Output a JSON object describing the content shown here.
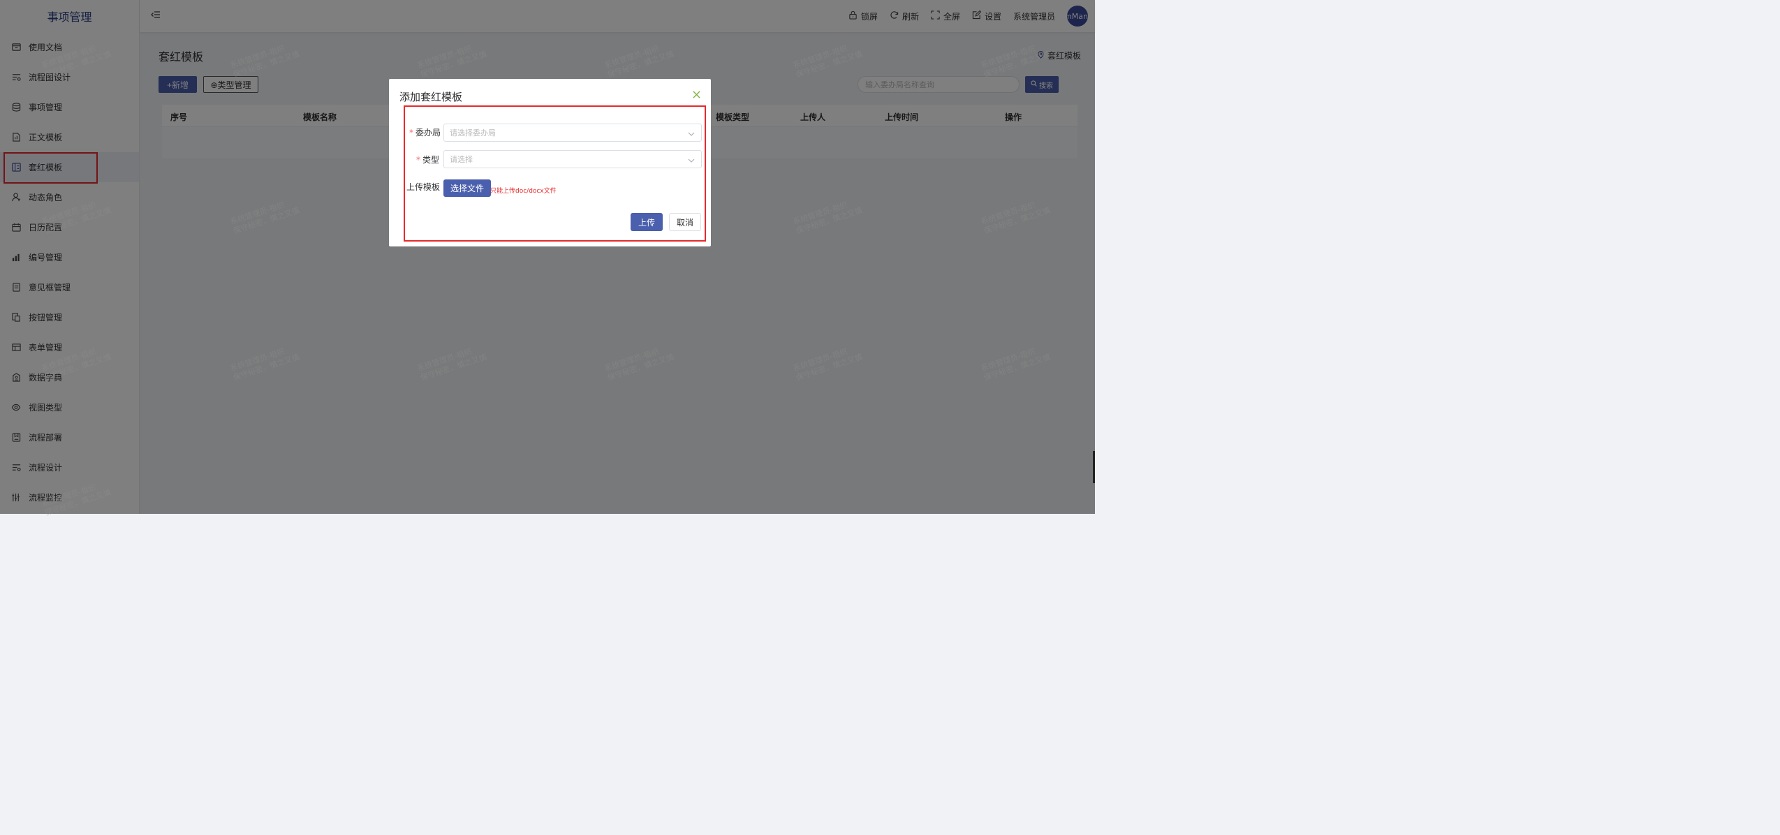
{
  "app": {
    "title": "事项管理"
  },
  "sidebar": {
    "items": [
      {
        "label": "使用文档",
        "icon": "archive-icon"
      },
      {
        "label": "流程图设计",
        "icon": "flow-list-icon"
      },
      {
        "label": "事项管理",
        "icon": "database-icon"
      },
      {
        "label": "正文模板",
        "icon": "document-chart-icon"
      },
      {
        "label": "套红模板",
        "icon": "template-icon"
      },
      {
        "label": "动态角色",
        "icon": "user-icon"
      },
      {
        "label": "日历配置",
        "icon": "calendar-icon"
      },
      {
        "label": "编号管理",
        "icon": "bar-chart-icon"
      },
      {
        "label": "意见框管理",
        "icon": "form-icon"
      },
      {
        "label": "按钮管理",
        "icon": "copy-icon"
      },
      {
        "label": "表单管理",
        "icon": "table-icon"
      },
      {
        "label": "数据字典",
        "icon": "dictionary-icon"
      },
      {
        "label": "视图类型",
        "icon": "eye-icon"
      },
      {
        "label": "流程部署",
        "icon": "deploy-icon"
      },
      {
        "label": "流程设计",
        "icon": "flow-design-icon"
      },
      {
        "label": "流程监控",
        "icon": "monitor-icon"
      }
    ],
    "active_index": 4
  },
  "header": {
    "lock": "锁屏",
    "refresh": "刷新",
    "fullscreen": "全屏",
    "settings": "设置",
    "user": "系统管理员",
    "avatar_text": "emMan"
  },
  "main": {
    "title": "套红模板",
    "breadcrumb": "套红模板",
    "add_button": "+新增",
    "type_button": "⊕类型管理",
    "search_placeholder": "输入委办局名称查询",
    "search_button": "搜索",
    "columns": [
      "序号",
      "模板名称",
      "模板类型",
      "上传人",
      "上传时间",
      "操作"
    ]
  },
  "dialog": {
    "title": "添加套红模板",
    "fields": {
      "bureau_label": "委办局",
      "bureau_placeholder": "请选择委办局",
      "type_label": "类型",
      "type_placeholder": "请选择",
      "upload_label": "上传模板"
    },
    "choose_file": "选择文件",
    "hint": "只能上传doc/docx文件",
    "upload": "上传",
    "cancel": "取消"
  },
  "watermark": {
    "line1": "系统管理员-祖织",
    "line2": "保守秘密，慎之又慎"
  },
  "colors": {
    "primary": "#4a5fad",
    "highlight": "#e8292a",
    "brand_text": "#2b3f84"
  }
}
